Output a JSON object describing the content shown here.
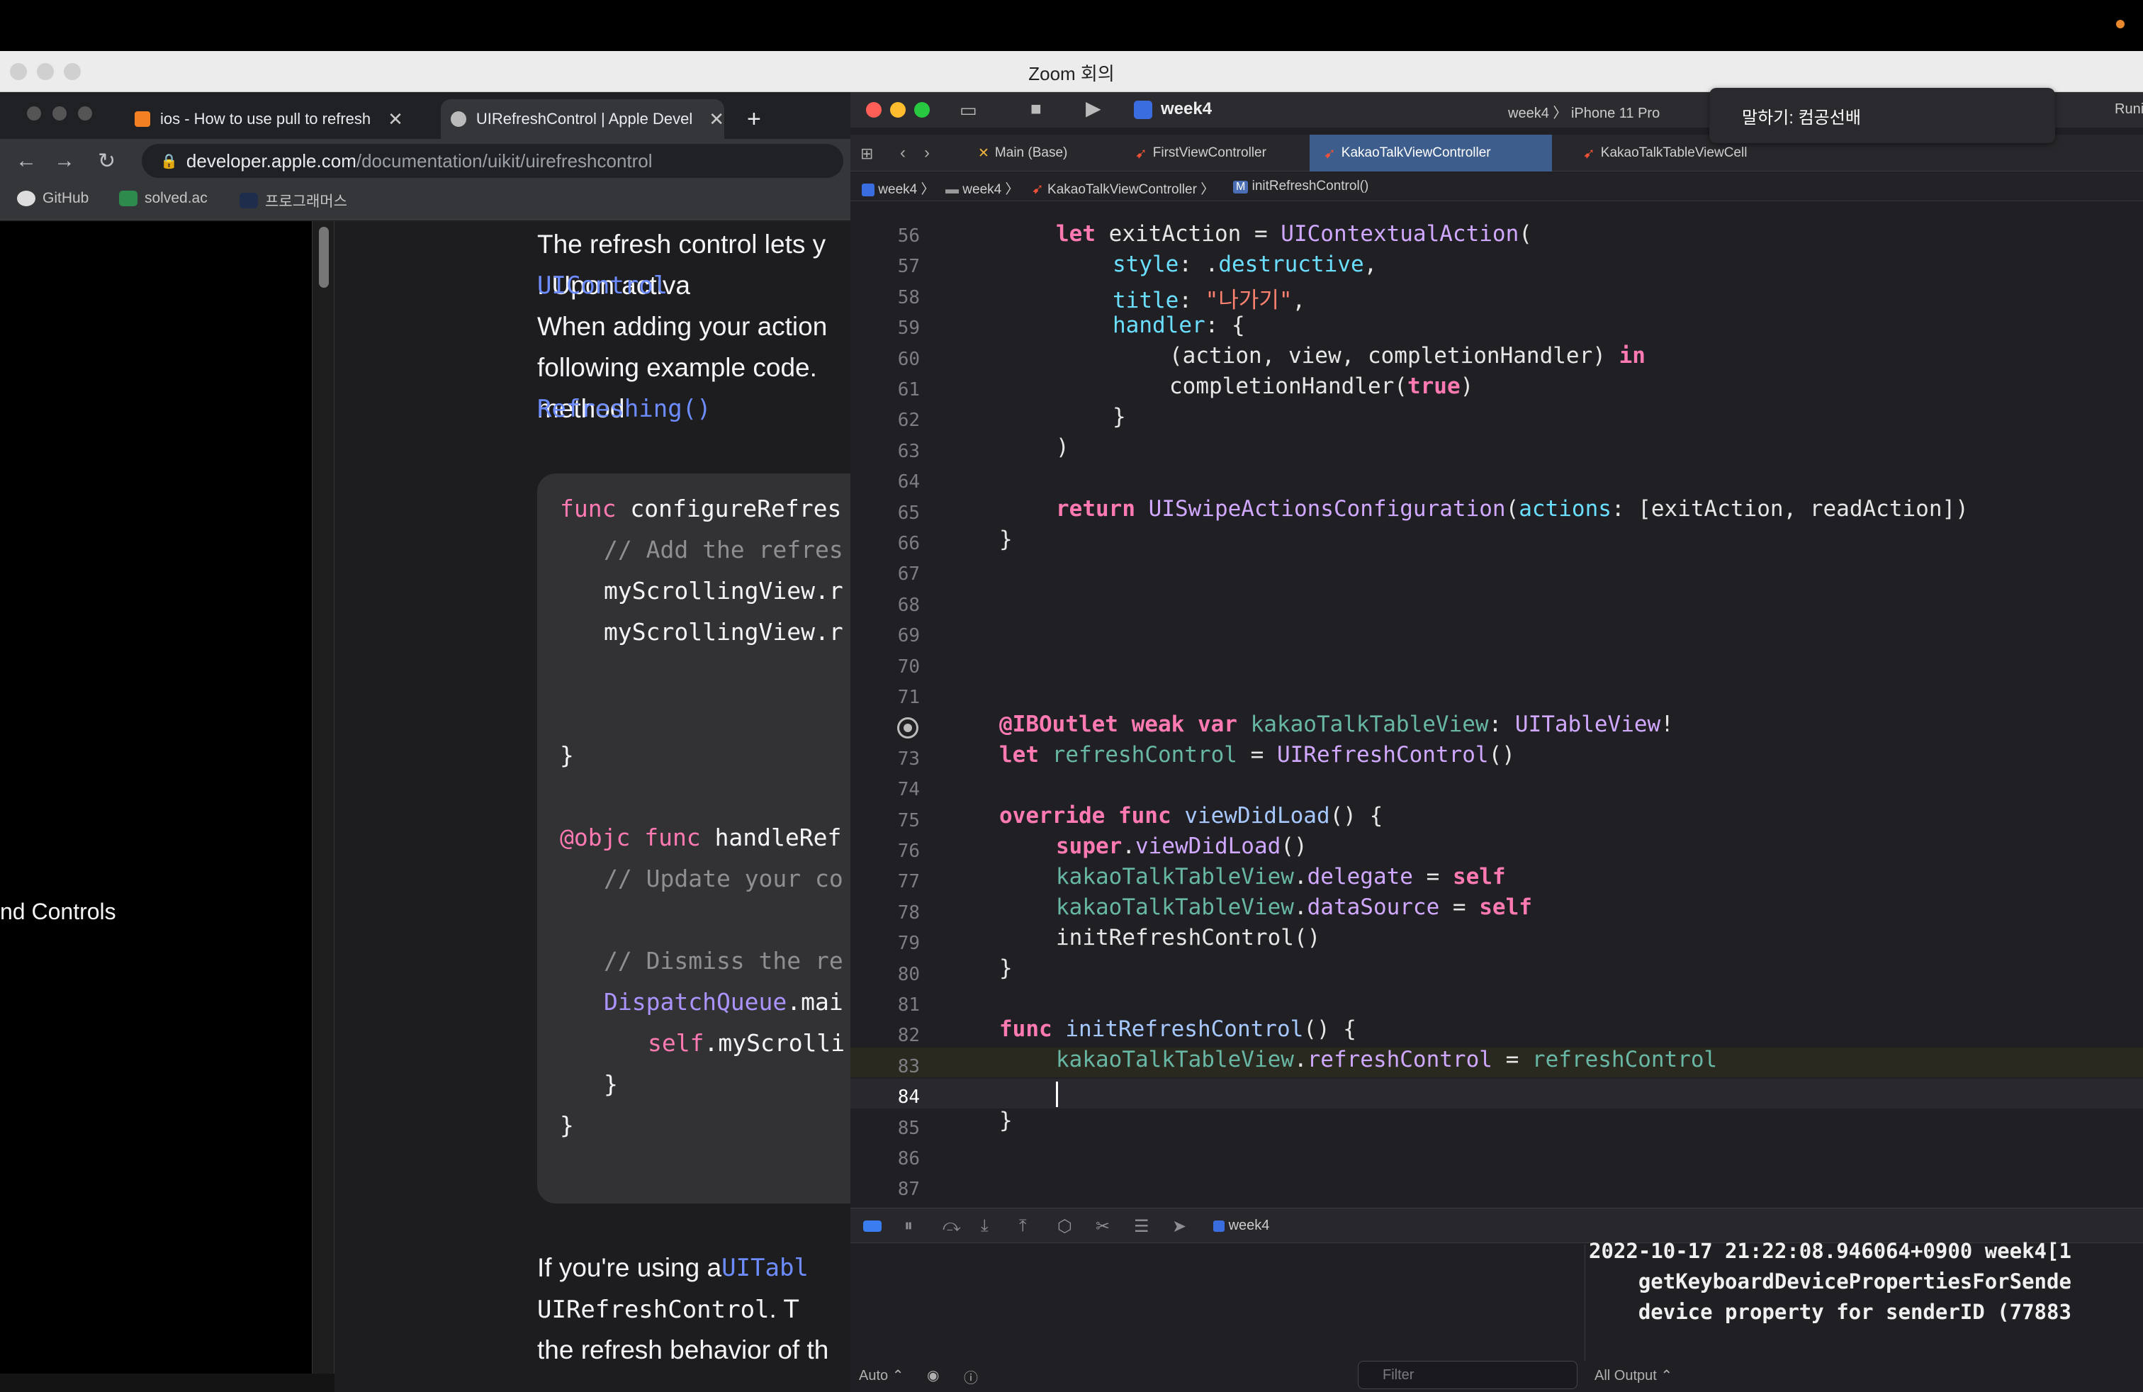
{
  "zoom": {
    "title": "Zoom 회의",
    "speaking": "말하기: 컴공선배"
  },
  "browser": {
    "tabs": [
      {
        "label": "ios - How to use pull to refresh"
      },
      {
        "label": "UIRefreshControl | Apple Devel"
      }
    ],
    "new_tab": "+",
    "url_host": "developer.apple.com",
    "url_path": "/documentation/uikit/uirefreshcontrol",
    "bookmarks": [
      "GitHub",
      "solved.ac",
      "프로그래머스"
    ],
    "sidebar_fragment": "nd Controls",
    "doc_lines": [
      "The refresh control lets y",
      "UIControl",
      ". Upon activa",
      "When adding your action",
      "following example code.",
      "Refreshing()",
      " method"
    ],
    "code_lines": [
      "func configureRefres",
      "// Add the refres",
      "myScrollingView.r",
      "myScrollingView.r",
      "}",
      "@objc func handleRef",
      "// Update your co",
      "// Dismiss the re",
      "DispatchQueue.mai",
      "self.myScrolli",
      "}",
      "}"
    ],
    "after": [
      "If you're using a ",
      "UITabl",
      "UIRefreshControl",
      ". T",
      "the refresh behavior of th"
    ]
  },
  "xcode": {
    "scheme": "week4",
    "scheme_target": "week4",
    "device": "iPhone 11 Pro",
    "run_status": "Runi",
    "tabs": [
      "Main (Base)",
      "FirstViewController",
      "KakaoTalkViewController",
      "KakaoTalkTableViewCell"
    ],
    "active_tab": "KakaoTalkViewController",
    "jumpbar": [
      "week4",
      "week4",
      "KakaoTalkViewController",
      "initRefreshControl()"
    ],
    "line_numbers": [
      "56",
      "57",
      "58",
      "59",
      "60",
      "61",
      "62",
      "63",
      "64",
      "65",
      "66",
      "67",
      "68",
      "69",
      "70",
      "71",
      "",
      "73",
      "74",
      "75",
      "76",
      "77",
      "78",
      "79",
      "80",
      "81",
      "82",
      "83",
      "84",
      "85",
      "86",
      "87"
    ],
    "current_line": "84",
    "debug_target": "week4",
    "console_lines": [
      "2022-10-17 21:22:08.946064+0900 week4[1",
      "    getKeyboardDevicePropertiesForSende",
      "    device property for senderID (77883"
    ],
    "bottom": {
      "auto": "Auto ⌃",
      "filter_placeholder": "Filter",
      "all_output": "All Output ⌃"
    }
  }
}
